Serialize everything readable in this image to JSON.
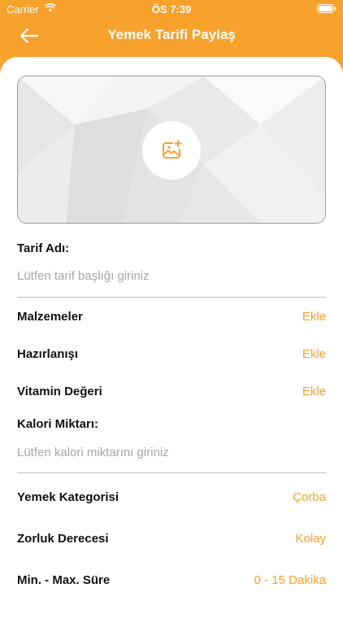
{
  "status_bar": {
    "carrier": "Carrier",
    "time": "ÖS 7:39"
  },
  "nav": {
    "title": "Yemek Tarifi Paylaş",
    "back_icon": "arrow-left-icon"
  },
  "image_picker": {
    "icon": "add-photo-icon"
  },
  "recipe_name": {
    "label": "Tarif Adı:",
    "placeholder": "Lütfen tarif başlığı giriniz",
    "value": ""
  },
  "ingredients": {
    "label": "Malzemeler",
    "action": "Ekle"
  },
  "preparation": {
    "label": "Hazırlanışı",
    "action": "Ekle"
  },
  "vitamins": {
    "label": "Vitamin Değeri",
    "action": "Ekle"
  },
  "calories": {
    "label": "Kalori Miktarı:",
    "placeholder": "Lütfen kalori miktarını giriniz",
    "value": ""
  },
  "category": {
    "label": "Yemek Kategorisi",
    "value": "Çorba"
  },
  "difficulty": {
    "label": "Zorluk Derecesi",
    "value": "Kolay"
  },
  "duration": {
    "label": "Min. - Max. Süre",
    "value": "0 - 15 Dakika"
  },
  "colors": {
    "accent": "#f6a22c"
  }
}
